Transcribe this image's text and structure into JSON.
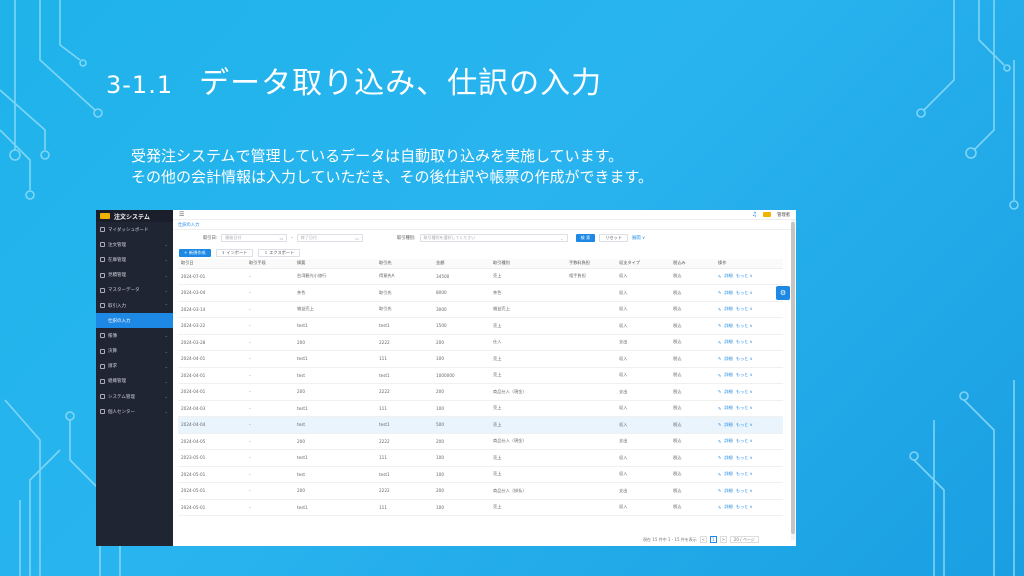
{
  "slide": {
    "number": "3-1.1",
    "title": "データ取り込み、仕訳の入力",
    "line1": "受発注システムで管理しているデータは自動取り込みを実施しています。",
    "line2": "その他の会計情報は入力していただき、その後仕訳や帳票の作成ができます。"
  },
  "colors": {
    "accent": "#1e88e5",
    "sidebar": "#1f2533",
    "background": "#1fb3ea"
  },
  "app": {
    "name": "注文システム",
    "user": "管理者",
    "tab": "仕訳の入力",
    "sidebar": [
      {
        "label": "マイダッシュボード",
        "icon": "dashboard-icon",
        "arrow": ""
      },
      {
        "label": "注文管理",
        "icon": "order-icon",
        "arrow": "⌄"
      },
      {
        "label": "在庫管理",
        "icon": "stock-icon",
        "arrow": "⌄"
      },
      {
        "label": "見積管理",
        "icon": "quote-icon",
        "arrow": "⌄"
      },
      {
        "label": "マスターデータ",
        "icon": "master-icon",
        "arrow": "⌄"
      },
      {
        "label": "取引入力",
        "icon": "entry-icon",
        "arrow": "⌃"
      },
      {
        "label": "仕訳の入力",
        "icon": "",
        "arrow": "",
        "sub": true,
        "active": true
      },
      {
        "label": "帳簿",
        "icon": "book-icon",
        "arrow": "⌄"
      },
      {
        "label": "決算",
        "icon": "settle-icon",
        "arrow": "⌄"
      },
      {
        "label": "請求",
        "icon": "bill-icon",
        "arrow": "⌄"
      },
      {
        "label": "組織管理",
        "icon": "org-icon",
        "arrow": "⌄"
      },
      {
        "label": "システム管理",
        "icon": "system-icon",
        "arrow": "⌄"
      },
      {
        "label": "個人センター",
        "icon": "user-icon",
        "arrow": "⌄"
      }
    ],
    "filters": {
      "date_label": "取引日:",
      "date_start": "開始日付",
      "date_sep": "-",
      "date_end": "終了日付",
      "type_label": "取引種別:",
      "type_placeholder": "取引種別を選択してください",
      "search": "検 索",
      "reset": "リセット",
      "expand": "展開 ∨"
    },
    "actions": {
      "add": "+ 新規作成",
      "import": "⇪ インポート",
      "export": "⇩ エクスポート"
    },
    "columns": [
      "取引日",
      "取引手段",
      "摘要",
      "取引先",
      "金額",
      "取引種別",
      "手数料負担",
      "収支タイプ",
      "税込み",
      "操作"
    ],
    "row_action": {
      "detail": "詳細",
      "more": "もっと ∨"
    },
    "rows": [
      [
        "2024-07-01",
        "-",
        "台湾観光小旅行",
        "得意先A",
        "34500",
        "売上",
        "相手負担",
        "収入",
        "税込"
      ],
      [
        "2024-03-04",
        "-",
        "茶色",
        "取引先",
        "8000",
        "茶色",
        "",
        "収入",
        "税込"
      ],
      [
        "2024-03-14",
        "-",
        "雑益売上",
        "取引先",
        "3000",
        "雑益売上",
        "",
        "収入",
        "税込"
      ],
      [
        "2024-03-22",
        "-",
        "test1",
        "test1",
        "1500",
        "売上",
        "",
        "収入",
        "税込"
      ],
      [
        "2024-03-28",
        "-",
        "200",
        "2222",
        "200",
        "仕入",
        "",
        "支出",
        "税込"
      ],
      [
        "2024-04-01",
        "-",
        "test1",
        "111",
        "100",
        "売上",
        "",
        "収入",
        "税込"
      ],
      [
        "2024-04-01",
        "-",
        "test",
        "test1",
        "1000000",
        "売上",
        "",
        "収入",
        "税込"
      ],
      [
        "2024-04-01",
        "-",
        "200",
        "2222",
        "200",
        "商品仕入（現金）",
        "",
        "支出",
        "税込"
      ],
      [
        "2024-04-03",
        "-",
        "test1",
        "111",
        "100",
        "売上",
        "",
        "収入",
        "税込"
      ],
      [
        "2024-04-04",
        "-",
        "test",
        "test1",
        "500",
        "売上",
        "",
        "収入",
        "税込"
      ],
      [
        "2024-04-05",
        "-",
        "200",
        "2222",
        "200",
        "商品仕入（現金）",
        "",
        "支出",
        "税込"
      ],
      [
        "2023-05-01",
        "-",
        "test1",
        "111",
        "100",
        "売上",
        "",
        "収入",
        "税込"
      ],
      [
        "2024-05-01",
        "-",
        "test",
        "test1",
        "100",
        "売上",
        "",
        "収入",
        "税込"
      ],
      [
        "2024-05-01",
        "-",
        "200",
        "2222",
        "200",
        "商品仕入（掛払）",
        "",
        "支出",
        "税込"
      ],
      [
        "2024-05-01",
        "-",
        "test1",
        "111",
        "100",
        "売上",
        "",
        "収入",
        "税込"
      ]
    ],
    "highlight_row": 9,
    "pager": {
      "summary": "現在 15 件中 1 - 15 件を表示",
      "prev": "<",
      "page": "1",
      "next": ">",
      "size": "20 / ページ"
    }
  }
}
